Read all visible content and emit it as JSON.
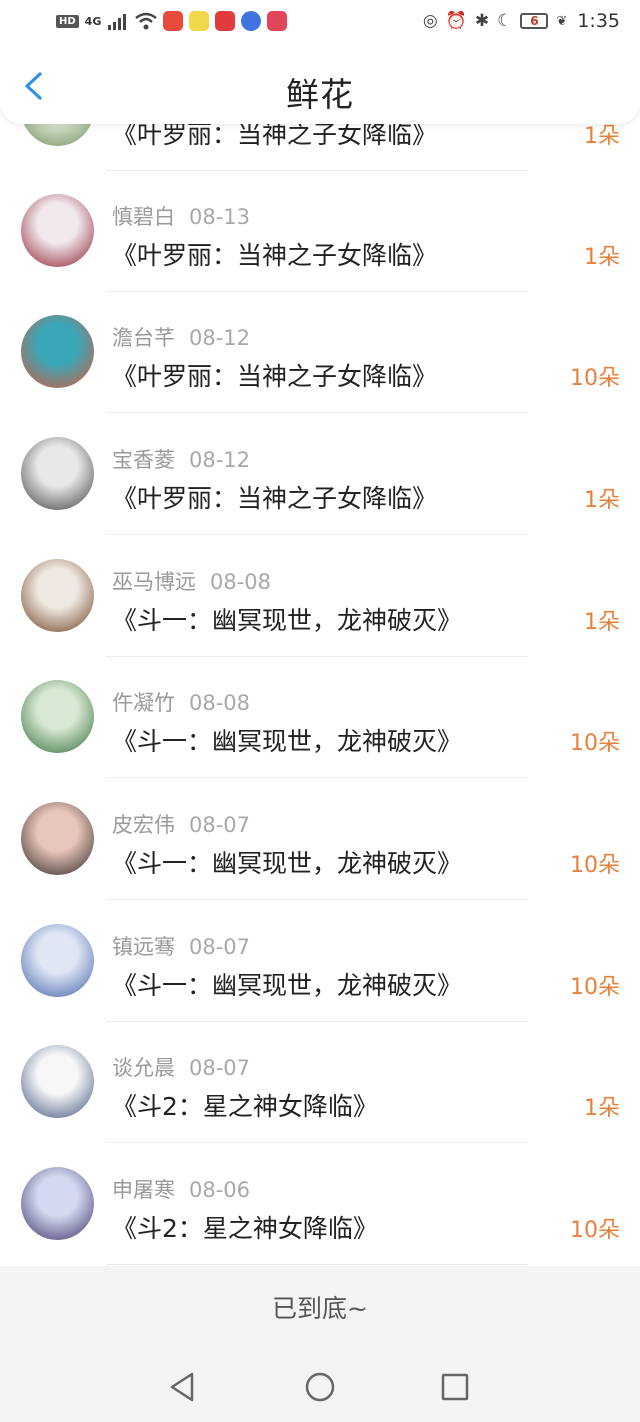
{
  "status_bar": {
    "network": "4G",
    "battery": "6",
    "time": "1:35"
  },
  "header": {
    "title": "鲜花"
  },
  "entries": [
    {
      "name": "",
      "date": "",
      "book": "《叶罗丽：当神之子女降临》",
      "amount": "1朵",
      "avatar_colors": [
        "#6b8e5a",
        "#dfe9d4"
      ]
    },
    {
      "name": "慎碧白",
      "date": "08-13",
      "book": "《叶罗丽：当神之子女降临》",
      "amount": "1朵",
      "avatar_colors": [
        "#8b1a2b",
        "#f1e9ee"
      ]
    },
    {
      "name": "澹台芊",
      "date": "08-12",
      "book": "《叶罗丽：当神之子女降临》",
      "amount": "10朵",
      "avatar_colors": [
        "#d9573a",
        "#3aa7b8"
      ]
    },
    {
      "name": "宝香菱",
      "date": "08-12",
      "book": "《叶罗丽：当神之子女降临》",
      "amount": "1朵",
      "avatar_colors": [
        "#3b3b3b",
        "#e8e8e8"
      ]
    },
    {
      "name": "巫马博远",
      "date": "08-08",
      "book": "《斗一：幽冥现世，龙神破灭》",
      "amount": "1朵",
      "avatar_colors": [
        "#6a3d1f",
        "#efe8e0"
      ]
    },
    {
      "name": "仵凝竹",
      "date": "08-08",
      "book": "《斗一：幽冥现世，龙神破灭》",
      "amount": "10朵",
      "avatar_colors": [
        "#2f6b36",
        "#d8e8d2"
      ]
    },
    {
      "name": "皮宏伟",
      "date": "08-07",
      "book": "《斗一：幽冥现世，龙神破灭》",
      "amount": "10朵",
      "avatar_colors": [
        "#2a2320",
        "#e9c6bb"
      ]
    },
    {
      "name": "镇远骞",
      "date": "08-07",
      "book": "《斗一：幽冥现世，龙神破灭》",
      "amount": "10朵",
      "avatar_colors": [
        "#3f5fa8",
        "#dfe6f4"
      ]
    },
    {
      "name": "谈允晨",
      "date": "08-07",
      "book": "《斗2：星之神女降临》",
      "amount": "1朵",
      "avatar_colors": [
        "#3b4f7a",
        "#f7f7f7"
      ]
    },
    {
      "name": "申屠寒",
      "date": "08-06",
      "book": "《斗2：星之神女降临》",
      "amount": "10朵",
      "avatar_colors": [
        "#3a2f66",
        "#d3d9f0"
      ]
    }
  ],
  "footer": {
    "end_text": "已到底~"
  },
  "colors": {
    "accent": "#e8803a",
    "back_arrow": "#2f8fe6"
  }
}
